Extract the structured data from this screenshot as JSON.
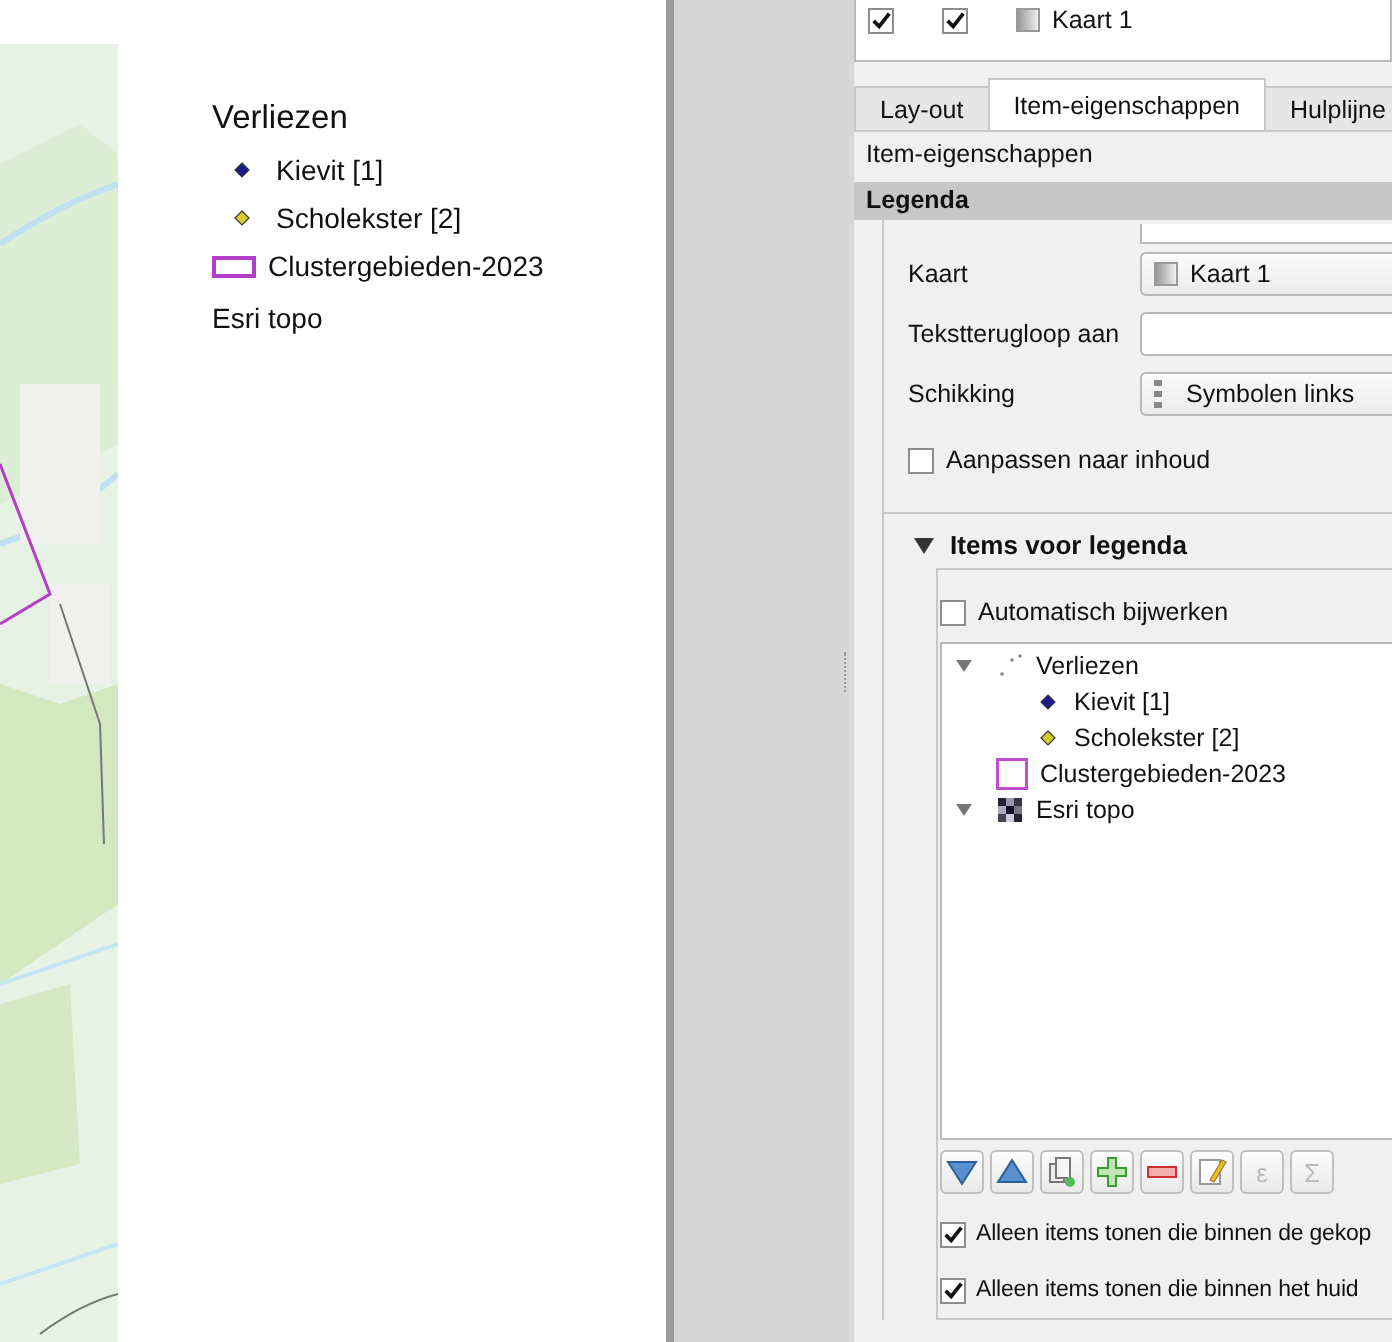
{
  "canvas": {
    "legend": [
      {
        "label": "Verliezen",
        "kind": "group"
      },
      {
        "label": "Kievit  [1]",
        "kind": "point",
        "color": "#1c1c8e"
      },
      {
        "label": "Scholekster  [2]",
        "kind": "point",
        "color": "#d6cf2a"
      },
      {
        "label": "Clustergebieden-2023",
        "kind": "polygon",
        "color": "#b13fc9"
      },
      {
        "label": "Esri topo",
        "kind": "raster"
      }
    ]
  },
  "panel": {
    "items_table": [
      {
        "visible": true,
        "locked": true,
        "label": "Kaart 1"
      }
    ],
    "tabs": [
      {
        "label": "Lay-out",
        "selected": false
      },
      {
        "label": "Item-eigenschappen",
        "selected": true
      },
      {
        "label": "Hulplijne",
        "selected": false
      }
    ],
    "subtitle": "Item-eigenschappen",
    "section": "Legenda",
    "fields": [
      {
        "kind": "text"
      },
      {
        "label": "Kaart",
        "kind": "map-combo",
        "value": "Kaart 1"
      },
      {
        "label": "Tekstterugloop aan",
        "kind": "text"
      },
      {
        "label": "Schikking",
        "kind": "arrange-combo",
        "value": "Symbolen links"
      }
    ],
    "fit_to_content": {
      "label": "Aanpassen naar inhoud",
      "checked": false
    },
    "items_group": {
      "title": "Items voor legenda",
      "expanded": true,
      "auto_update": {
        "label": "Automatisch bijwerken",
        "checked": false
      },
      "tree": [
        {
          "label": "Verliezen",
          "kind": "group",
          "expanded": true,
          "children": [
            {
              "label": "Kievit  [1]",
              "kind": "point",
              "color": "#1c1c8e"
            },
            {
              "label": "Scholekster  [2]",
              "kind": "point",
              "color": "#d6cf2a"
            }
          ]
        },
        {
          "label": "Clustergebieden-2023",
          "kind": "polygon",
          "color": "#c04fd0"
        },
        {
          "label": "Esri topo",
          "kind": "raster",
          "expanded": true
        }
      ],
      "toolbar": [
        {
          "kind": "down",
          "disabled": false
        },
        {
          "kind": "up",
          "disabled": false
        },
        {
          "kind": "copy",
          "disabled": false
        },
        {
          "kind": "add",
          "disabled": false
        },
        {
          "kind": "remove",
          "disabled": false
        },
        {
          "kind": "edit",
          "disabled": false
        },
        {
          "kind": "glyph",
          "text": "ε",
          "disabled": true
        },
        {
          "kind": "glyph",
          "text": "Σ",
          "disabled": true
        }
      ],
      "filters": [
        {
          "label": "Alleen items tonen die binnen de gekop",
          "checked": true
        },
        {
          "label": "Alleen items tonen die binnen het huid",
          "checked": true
        }
      ]
    }
  }
}
